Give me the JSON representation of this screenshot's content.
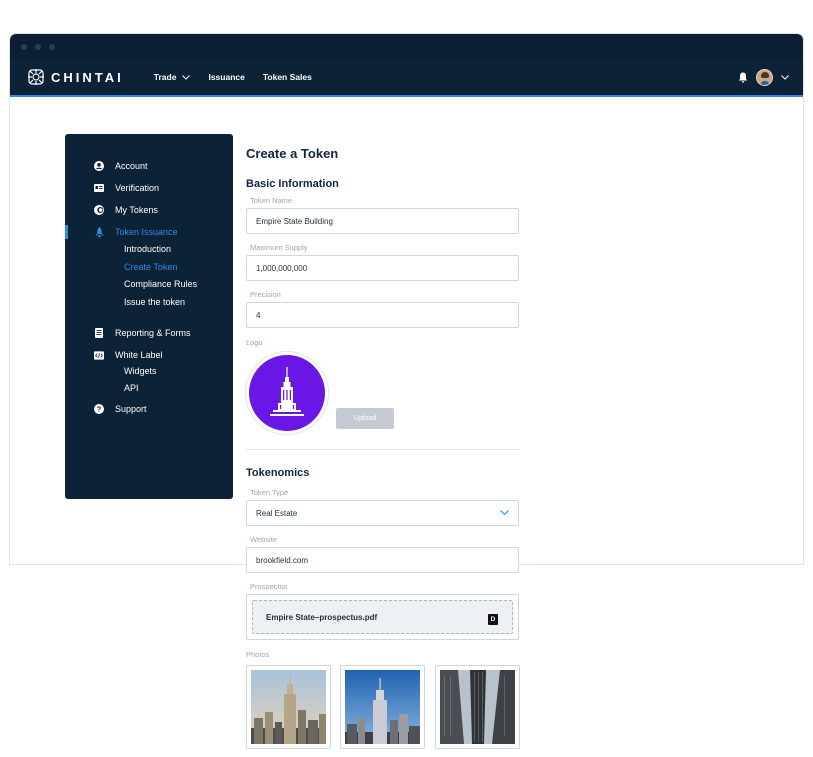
{
  "window": {
    "brand": "CHINTAI"
  },
  "nav": {
    "links": [
      {
        "label": "Trade",
        "has_dropdown": true
      },
      {
        "label": "Issuance"
      },
      {
        "label": "Token Sales"
      }
    ],
    "icons": [
      "bell-icon",
      "avatar",
      "chevron-down-icon"
    ]
  },
  "sidebar": {
    "items": [
      {
        "label": "Account",
        "icon": "user-circle-icon"
      },
      {
        "label": "Verification",
        "icon": "id-card-icon"
      },
      {
        "label": "My Tokens",
        "icon": "token-icon"
      },
      {
        "label": "Token Issuance",
        "icon": "rocket-icon",
        "active": true,
        "sub": [
          "Introduction",
          "Create Token",
          "Compliance Rules",
          "Issue the token"
        ]
      },
      {
        "label": "Reporting & Forms",
        "icon": "document-icon"
      },
      {
        "label": "White Label",
        "icon": "code-icon",
        "sub": [
          "Widgets",
          "API"
        ]
      },
      {
        "label": "Support",
        "icon": "help-icon"
      }
    ],
    "active_sub": "Create Token"
  },
  "page": {
    "title": "Create a Token",
    "basic_heading": "Basic Information",
    "token_name_label": "Token Name",
    "token_name_value": "Empire State Building",
    "max_supply_label": "Maximum Supply",
    "max_supply_value": "1,000,000,000",
    "precision_label": "Precision",
    "precision_value": "4",
    "logo_label": "Logo",
    "upload_label": "Upload",
    "tokenomics_heading": "Tokenomics",
    "token_type_label": "Token Type",
    "token_type_value": "Real Estate",
    "website_label": "Website",
    "website_value": "brookfield.com",
    "prospectus_label": "Prospectus",
    "prospectus_file": "Empire State–prospectus.pdf",
    "pdf_icon_glyph": "D",
    "photos_label": "Photos"
  },
  "colors": {
    "navy": "#0c2236",
    "accent": "#2f8ae6",
    "logo_bg": "#6a17e6"
  }
}
